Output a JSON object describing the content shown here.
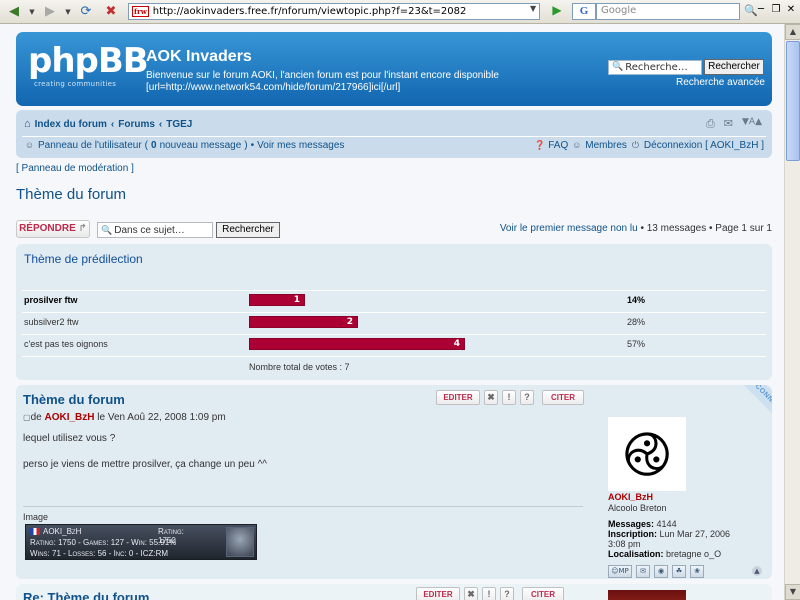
{
  "browser": {
    "url": "http://aokinvaders.free.fr/nforum/viewtopic.php?f=23&t=2082",
    "favicon": "frw",
    "search_engine": "G",
    "search_placeholder": "Google",
    "back_icon": "back-arrow-icon",
    "forward_icon": "forward-arrow-icon",
    "reload_icon": "reload-icon",
    "stop_icon": "stop-icon",
    "home_icon": "home-icon"
  },
  "header": {
    "logo_text": "phpBB",
    "logo_sub": "creating  communities",
    "site_title": "AOK Invaders",
    "description_line1": "Bienvenue sur le forum AOKI, l'ancien forum est pour l'instant encore disponible",
    "description_line2": "[url=http://www.network54.com/hide/forum/217966]ici[/url]",
    "search_placeholder": "Recherche…",
    "search_button": "Rechercher",
    "advanced_search": "Recherche avancée"
  },
  "navbar": {
    "breadcrumb": [
      "Index du forum",
      "Forums",
      "TGEJ"
    ],
    "separator": "‹",
    "user_panel": "Panneau de l'utilisateur",
    "new_messages_count": "0",
    "new_messages_label": "nouveau message",
    "view_messages": "Voir mes messages",
    "faq": "FAQ",
    "members": "Membres",
    "logout": "Déconnexion [ AOKI_BzH ]"
  },
  "moderation_panel": "[ Panneau de modération ]",
  "topic": {
    "title": "Thème du forum",
    "reply_button": "RÉPONDRE",
    "search_placeholder": "Dans ce sujet…",
    "search_button": "Rechercher",
    "first_unread": "Voir le premier message non lu",
    "message_count": "13 messages",
    "page_info": "Page 1 sur 1"
  },
  "poll": {
    "question": "Thème de prédilection",
    "options": [
      {
        "label": "prosilver ftw",
        "votes": "1",
        "percent": "14%",
        "bold": true
      },
      {
        "label": "subsilver2 ftw",
        "votes": "2",
        "percent": "28%",
        "bold": false
      },
      {
        "label": "c'est pas tes oignons",
        "votes": "4",
        "percent": "57%",
        "bold": false
      }
    ],
    "total": "Nombre total de votes : 7",
    "accent_color": "#aa0033"
  },
  "post1": {
    "title": "Thème du forum",
    "prefix": "de",
    "author": "AOKI_BzH",
    "date": "le Ven Aoû 22, 2008 1:09 pm",
    "body_line1": "lequel utilisez vous ?",
    "body_line2": "perso je viens de mettre prosilver, ça change un peu ^^",
    "sig_label": "Image",
    "sig_line1_name": "AOKI_BzH",
    "sig_line1_rating": "Rating: 1750",
    "sig_line2": "Rating: 1750 - Games: 127 - Win: 55.91%",
    "sig_line3": "Wins: 71 - Losses: 56 - Inc: 0 - ICZ:RM",
    "buttons": {
      "edit": "EDITER",
      "quote": "CITER"
    },
    "online": "CONNECTÉ"
  },
  "profile": {
    "avatar_glyph": "࿋",
    "name": "AOKI_BzH",
    "rank": "Alcoolo Breton",
    "messages_label": "Messages:",
    "messages_value": "4144",
    "inscription_label": "Inscription:",
    "inscription_value": "Lun Mar 27, 2006 3:08 pm",
    "location_label": "Localisation:",
    "location_value": "bretagne o_O",
    "pm_label": "MP"
  },
  "post2": {
    "title": "Re: Thème du forum",
    "buttons": {
      "edit": "EDITER",
      "quote": "CITER"
    }
  }
}
